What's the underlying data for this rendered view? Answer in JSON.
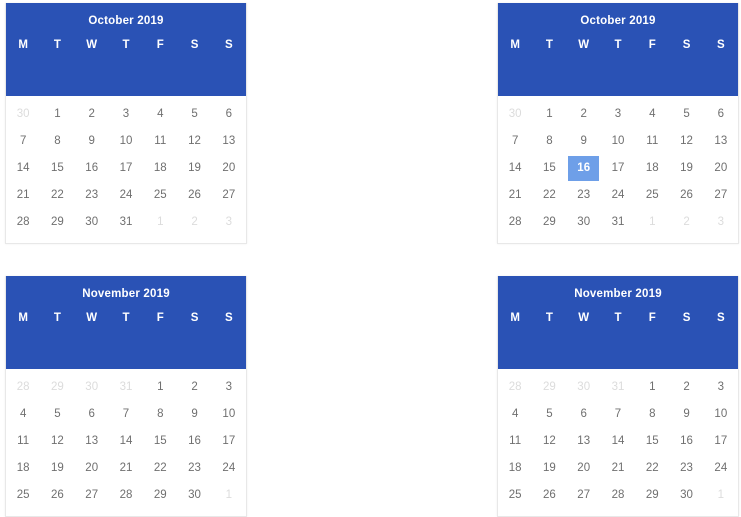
{
  "accent_color": "#2a52b5",
  "selected_color": "#6e9fe8",
  "day_color": "#6f6f6f",
  "muted_day_color": "#dcdcdc",
  "weekday_labels": [
    "M",
    "T",
    "W",
    "T",
    "F",
    "S",
    "S"
  ],
  "calendars": [
    {
      "id": "calendar-october-left",
      "title": "October 2019",
      "selected": null,
      "weeks": [
        [
          {
            "label": "30",
            "muted": true
          },
          {
            "label": "1",
            "muted": false
          },
          {
            "label": "2",
            "muted": false
          },
          {
            "label": "3",
            "muted": false
          },
          {
            "label": "4",
            "muted": false
          },
          {
            "label": "5",
            "muted": false
          },
          {
            "label": "6",
            "muted": false
          }
        ],
        [
          {
            "label": "7",
            "muted": false
          },
          {
            "label": "8",
            "muted": false
          },
          {
            "label": "9",
            "muted": false
          },
          {
            "label": "10",
            "muted": false
          },
          {
            "label": "11",
            "muted": false
          },
          {
            "label": "12",
            "muted": false
          },
          {
            "label": "13",
            "muted": false
          }
        ],
        [
          {
            "label": "14",
            "muted": false
          },
          {
            "label": "15",
            "muted": false
          },
          {
            "label": "16",
            "muted": false
          },
          {
            "label": "17",
            "muted": false
          },
          {
            "label": "18",
            "muted": false
          },
          {
            "label": "19",
            "muted": false
          },
          {
            "label": "20",
            "muted": false
          }
        ],
        [
          {
            "label": "21",
            "muted": false
          },
          {
            "label": "22",
            "muted": false
          },
          {
            "label": "23",
            "muted": false
          },
          {
            "label": "24",
            "muted": false
          },
          {
            "label": "25",
            "muted": false
          },
          {
            "label": "26",
            "muted": false
          },
          {
            "label": "27",
            "muted": false
          }
        ],
        [
          {
            "label": "28",
            "muted": false
          },
          {
            "label": "29",
            "muted": false
          },
          {
            "label": "30",
            "muted": false
          },
          {
            "label": "31",
            "muted": false
          },
          {
            "label": "1",
            "muted": true
          },
          {
            "label": "2",
            "muted": true
          },
          {
            "label": "3",
            "muted": true
          }
        ]
      ]
    },
    {
      "id": "calendar-october-right",
      "title": "October 2019",
      "selected": "16",
      "weeks": [
        [
          {
            "label": "30",
            "muted": true
          },
          {
            "label": "1",
            "muted": false
          },
          {
            "label": "2",
            "muted": false
          },
          {
            "label": "3",
            "muted": false
          },
          {
            "label": "4",
            "muted": false
          },
          {
            "label": "5",
            "muted": false
          },
          {
            "label": "6",
            "muted": false
          }
        ],
        [
          {
            "label": "7",
            "muted": false
          },
          {
            "label": "8",
            "muted": false
          },
          {
            "label": "9",
            "muted": false
          },
          {
            "label": "10",
            "muted": false
          },
          {
            "label": "11",
            "muted": false
          },
          {
            "label": "12",
            "muted": false
          },
          {
            "label": "13",
            "muted": false
          }
        ],
        [
          {
            "label": "14",
            "muted": false
          },
          {
            "label": "15",
            "muted": false
          },
          {
            "label": "16",
            "muted": false,
            "selected": true
          },
          {
            "label": "17",
            "muted": false
          },
          {
            "label": "18",
            "muted": false
          },
          {
            "label": "19",
            "muted": false
          },
          {
            "label": "20",
            "muted": false
          }
        ],
        [
          {
            "label": "21",
            "muted": false
          },
          {
            "label": "22",
            "muted": false
          },
          {
            "label": "23",
            "muted": false
          },
          {
            "label": "24",
            "muted": false
          },
          {
            "label": "25",
            "muted": false
          },
          {
            "label": "26",
            "muted": false
          },
          {
            "label": "27",
            "muted": false
          }
        ],
        [
          {
            "label": "28",
            "muted": false
          },
          {
            "label": "29",
            "muted": false
          },
          {
            "label": "30",
            "muted": false
          },
          {
            "label": "31",
            "muted": false
          },
          {
            "label": "1",
            "muted": true
          },
          {
            "label": "2",
            "muted": true
          },
          {
            "label": "3",
            "muted": true
          }
        ]
      ]
    },
    {
      "id": "calendar-november-left",
      "title": "November 2019",
      "selected": null,
      "weeks": [
        [
          {
            "label": "28",
            "muted": true
          },
          {
            "label": "29",
            "muted": true
          },
          {
            "label": "30",
            "muted": true
          },
          {
            "label": "31",
            "muted": true
          },
          {
            "label": "1",
            "muted": false
          },
          {
            "label": "2",
            "muted": false
          },
          {
            "label": "3",
            "muted": false
          }
        ],
        [
          {
            "label": "4",
            "muted": false
          },
          {
            "label": "5",
            "muted": false
          },
          {
            "label": "6",
            "muted": false
          },
          {
            "label": "7",
            "muted": false
          },
          {
            "label": "8",
            "muted": false
          },
          {
            "label": "9",
            "muted": false
          },
          {
            "label": "10",
            "muted": false
          }
        ],
        [
          {
            "label": "11",
            "muted": false
          },
          {
            "label": "12",
            "muted": false
          },
          {
            "label": "13",
            "muted": false
          },
          {
            "label": "14",
            "muted": false
          },
          {
            "label": "15",
            "muted": false
          },
          {
            "label": "16",
            "muted": false
          },
          {
            "label": "17",
            "muted": false
          }
        ],
        [
          {
            "label": "18",
            "muted": false
          },
          {
            "label": "19",
            "muted": false
          },
          {
            "label": "20",
            "muted": false
          },
          {
            "label": "21",
            "muted": false
          },
          {
            "label": "22",
            "muted": false
          },
          {
            "label": "23",
            "muted": false
          },
          {
            "label": "24",
            "muted": false
          }
        ],
        [
          {
            "label": "25",
            "muted": false
          },
          {
            "label": "26",
            "muted": false
          },
          {
            "label": "27",
            "muted": false
          },
          {
            "label": "28",
            "muted": false
          },
          {
            "label": "29",
            "muted": false
          },
          {
            "label": "30",
            "muted": false
          },
          {
            "label": "1",
            "muted": true
          }
        ]
      ]
    },
    {
      "id": "calendar-november-right",
      "title": "November 2019",
      "selected": null,
      "weeks": [
        [
          {
            "label": "28",
            "muted": true
          },
          {
            "label": "29",
            "muted": true
          },
          {
            "label": "30",
            "muted": true
          },
          {
            "label": "31",
            "muted": true
          },
          {
            "label": "1",
            "muted": false
          },
          {
            "label": "2",
            "muted": false
          },
          {
            "label": "3",
            "muted": false
          }
        ],
        [
          {
            "label": "4",
            "muted": false
          },
          {
            "label": "5",
            "muted": false
          },
          {
            "label": "6",
            "muted": false
          },
          {
            "label": "7",
            "muted": false
          },
          {
            "label": "8",
            "muted": false
          },
          {
            "label": "9",
            "muted": false
          },
          {
            "label": "10",
            "muted": false
          }
        ],
        [
          {
            "label": "11",
            "muted": false
          },
          {
            "label": "12",
            "muted": false
          },
          {
            "label": "13",
            "muted": false
          },
          {
            "label": "14",
            "muted": false
          },
          {
            "label": "15",
            "muted": false
          },
          {
            "label": "16",
            "muted": false
          },
          {
            "label": "17",
            "muted": false
          }
        ],
        [
          {
            "label": "18",
            "muted": false
          },
          {
            "label": "19",
            "muted": false
          },
          {
            "label": "20",
            "muted": false
          },
          {
            "label": "21",
            "muted": false
          },
          {
            "label": "22",
            "muted": false
          },
          {
            "label": "23",
            "muted": false
          },
          {
            "label": "24",
            "muted": false
          }
        ],
        [
          {
            "label": "25",
            "muted": false
          },
          {
            "label": "26",
            "muted": false
          },
          {
            "label": "27",
            "muted": false
          },
          {
            "label": "28",
            "muted": false
          },
          {
            "label": "29",
            "muted": false
          },
          {
            "label": "30",
            "muted": false
          },
          {
            "label": "1",
            "muted": true
          }
        ]
      ]
    }
  ]
}
